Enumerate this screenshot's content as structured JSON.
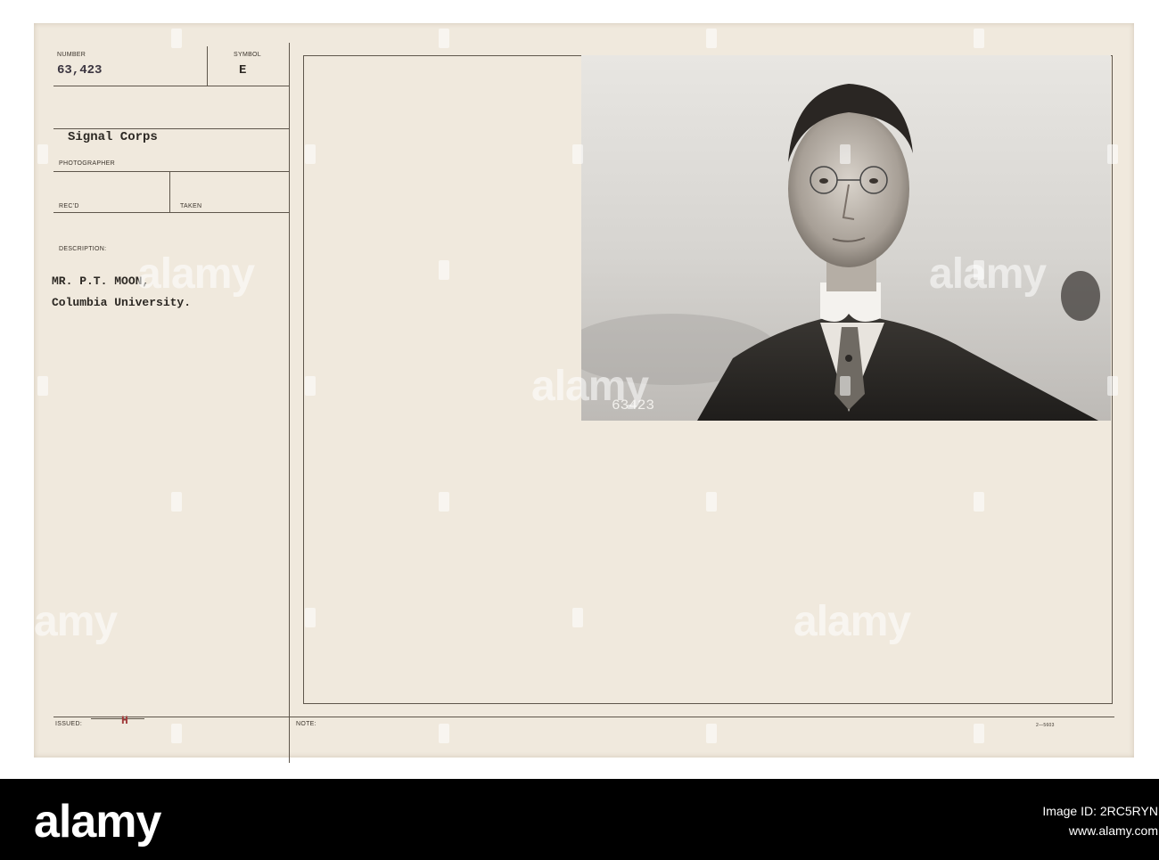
{
  "card": {
    "number_label": "NUMBER",
    "number_value": "63,423",
    "symbol_label": "SYMBOL",
    "symbol_value": "E",
    "organization": "Signal Corps",
    "photographer_label": "PHOTOGRAPHER",
    "recd_label": "REC'D",
    "taken_label": "TAKEN",
    "description_label": "DESCRIPTION:",
    "description_line1": "MR. P.T. MOON,",
    "description_line2": "Columbia University.",
    "issued_label": "ISSUED:",
    "issued_value": "H",
    "note_label": "NOTE:",
    "form_number": "2—5603"
  },
  "photo": {
    "caption_number": "63423"
  },
  "watermark_text": "alamy",
  "brand": {
    "logo": "alamy",
    "image_id_label": "Image ID: 2RC5RYN",
    "url": "www.alamy.com"
  }
}
